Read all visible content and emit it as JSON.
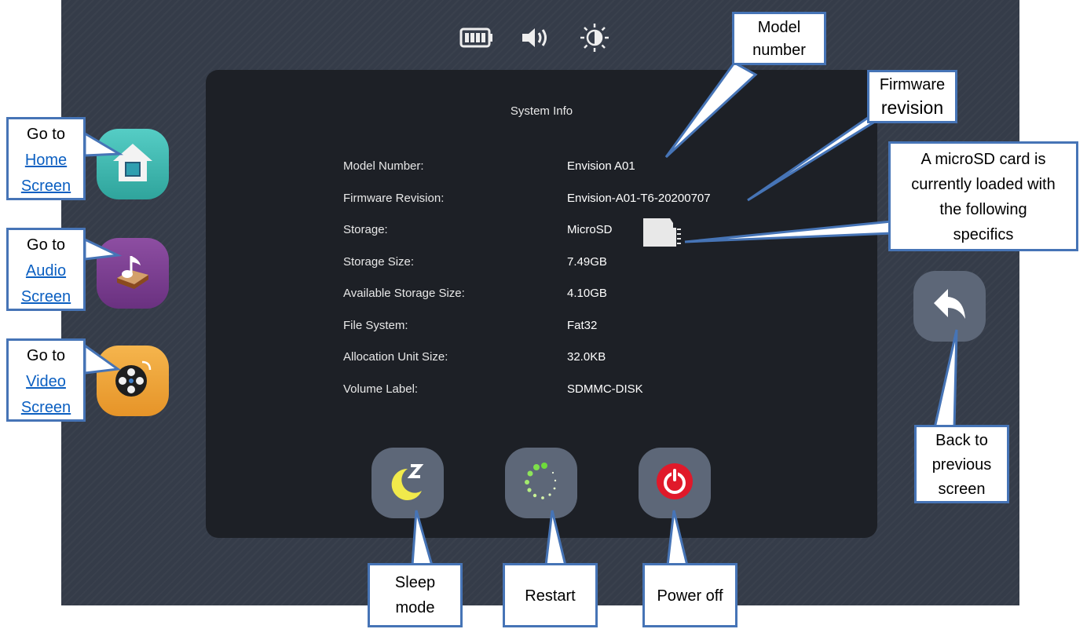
{
  "panel": {
    "title": "System Info",
    "rows": [
      {
        "label": "Model Number:",
        "value": "Envision  A01"
      },
      {
        "label": "Firmware Revision:",
        "value": "Envision-A01-T6-20200707"
      },
      {
        "label": "Storage:",
        "value": "MicroSD"
      },
      {
        "label": "Storage Size:",
        "value": "7.49GB"
      },
      {
        "label": "Available Storage Size:",
        "value": "4.10GB"
      },
      {
        "label": "File System:",
        "value": "Fat32"
      },
      {
        "label": "Allocation Unit Size:",
        "value": "32.0KB"
      },
      {
        "label": "Volume Label:",
        "value": "SDMMC-DISK"
      }
    ]
  },
  "status_icons": [
    "battery-icon",
    "speaker-icon",
    "brightness-icon"
  ],
  "side_buttons": [
    {
      "name": "home-button",
      "icon": "house-icon",
      "color": "#3fb6b0"
    },
    {
      "name": "audio-button",
      "icon": "music-book-icon",
      "color": "#7a3f8e"
    },
    {
      "name": "video-button",
      "icon": "film-reel-icon",
      "color": "#f0a33a"
    }
  ],
  "bottom_buttons": [
    {
      "name": "sleep-button",
      "icon": "moon-icon"
    },
    {
      "name": "restart-button",
      "icon": "spinner-icon"
    },
    {
      "name": "power-button",
      "icon": "power-icon",
      "color": "#e0192a"
    }
  ],
  "back_button": {
    "icon": "back-arrow-icon"
  },
  "callouts": {
    "home": {
      "line1": "Go to",
      "line2": "Home",
      "line3": "Screen"
    },
    "audio": {
      "line1": "Go to",
      "line2": "Audio",
      "line3": "Screen"
    },
    "video": {
      "line1": "Go to",
      "line2": "Video",
      "line3": "Screen"
    },
    "model": {
      "line1": "Model",
      "line2": "number"
    },
    "firmware": {
      "line1": "Firmware",
      "line2": "revision"
    },
    "microsd": {
      "line1": "A microSD card is",
      "line2": "currently loaded with",
      "line3": "the following",
      "line4": "specifics"
    },
    "back": {
      "line1": "Back to",
      "line2": "previous",
      "line3": "screen"
    },
    "sleep": {
      "line1": "Sleep",
      "line2": "mode"
    },
    "restart": {
      "line1": "Restart"
    },
    "power": {
      "line1": "Power off"
    }
  },
  "colors": {
    "accent": "#4674b6",
    "panel": "#1d2026",
    "background": "#353c49"
  }
}
